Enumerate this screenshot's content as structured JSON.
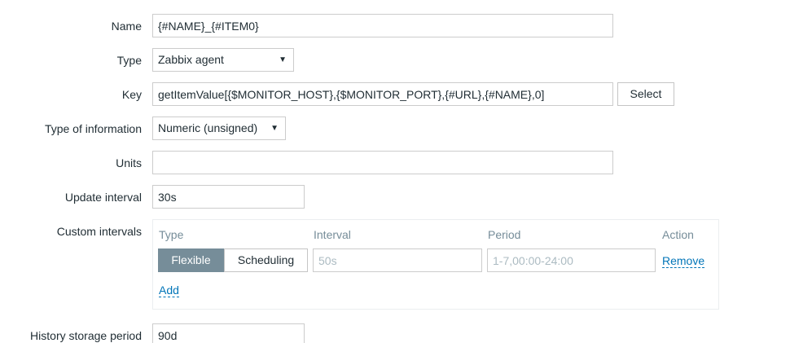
{
  "form": {
    "name": {
      "label": "Name",
      "value": "{#NAME}_{#ITEM0}"
    },
    "type": {
      "label": "Type",
      "value": "Zabbix agent"
    },
    "key": {
      "label": "Key",
      "value": "getItemValue[{$MONITOR_HOST},{$MONITOR_PORT},{#URL},{#NAME},0]",
      "select_label": "Select"
    },
    "type_of_information": {
      "label": "Type of information",
      "value": "Numeric (unsigned)"
    },
    "units": {
      "label": "Units",
      "value": ""
    },
    "update_interval": {
      "label": "Update interval",
      "value": "30s"
    },
    "custom_intervals": {
      "label": "Custom intervals",
      "headers": {
        "type": "Type",
        "interval": "Interval",
        "period": "Period",
        "action": "Action"
      },
      "row": {
        "type_options": [
          "Flexible",
          "Scheduling"
        ],
        "selected_type": "Flexible",
        "interval_placeholder": "50s",
        "period_placeholder": "1-7,00:00-24:00",
        "remove_label": "Remove"
      },
      "add_label": "Add"
    },
    "history_storage_period": {
      "label": "History storage period",
      "value": "90d"
    }
  },
  "colors": {
    "label_text": "#1f2c33",
    "muted_header": "#768d99",
    "link": "#0275b8",
    "active_segment": "#768d99",
    "border": "#cccccc",
    "placeholder": "#acbbc2"
  }
}
